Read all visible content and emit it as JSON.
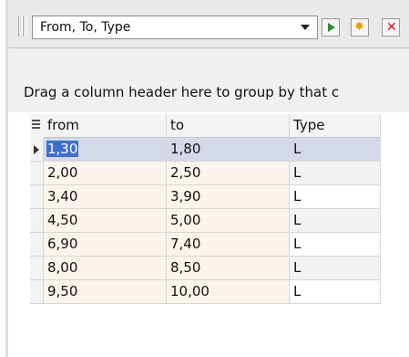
{
  "toolbar": {
    "filter_combo_value": "From, To, Type",
    "apply_icon": "play-icon",
    "customize_icon": "star-icon",
    "clear_icon": "close-icon"
  },
  "group_panel": {
    "text": "Drag a column header here to group by that c"
  },
  "grid": {
    "columns": [
      "from",
      "to",
      "Type"
    ],
    "rows": [
      {
        "from": "1,30",
        "to": "1,80",
        "type": "L"
      },
      {
        "from": "2,00",
        "to": "2,50",
        "type": "L"
      },
      {
        "from": "3,40",
        "to": "3,90",
        "type": "L"
      },
      {
        "from": "4,50",
        "to": "5,00",
        "type": "L"
      },
      {
        "from": "6,90",
        "to": "7,40",
        "type": "L"
      },
      {
        "from": "8,00",
        "to": "8,50",
        "type": "L"
      },
      {
        "from": "9,50",
        "to": "10,00",
        "type": "L"
      }
    ],
    "selected_row": 0
  },
  "colors": {
    "toolbar_bg": "#e9e9e9",
    "group_panel_bg": "#f0f0f0",
    "data_cell_bg": "#fbf4ec",
    "selected_row_bg": "#d3d9ea",
    "selection_highlight": "#3f6fce"
  }
}
